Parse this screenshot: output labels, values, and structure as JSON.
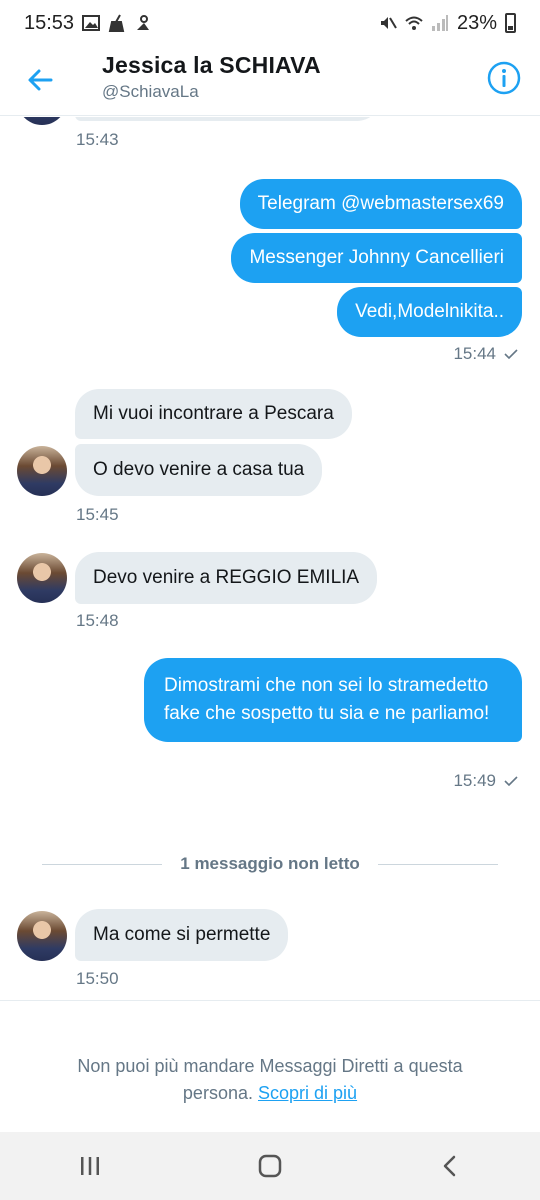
{
  "status_bar": {
    "time": "15:53",
    "battery": "23%"
  },
  "header": {
    "title": "Jessica la SCHIAVA",
    "handle": "@SchiavaLa"
  },
  "messages": {
    "time_1": "15:43",
    "out_1": "Telegram @webmastersex69",
    "out_2": "Messenger Johnny Cancellieri",
    "out_3": "Vedi,Modelnikita..",
    "time_2": "15:44",
    "in_1": "Mi vuoi incontrare a Pescara",
    "in_2": "O devo venire a casa tua",
    "time_3": "15:45",
    "in_3": "Devo venire a REGGIO EMILIA",
    "time_4": "15:48",
    "out_4": "Dimostrami che non sei lo stramedetto fake che sospetto tu sia e ne parliamo!",
    "time_5": "15:49",
    "unread_label": "1 messaggio non letto",
    "in_4": "Ma come si permette",
    "time_6": "15:50"
  },
  "footer": {
    "notice": "Non puoi più mandare Messaggi Diretti a questa persona.",
    "link": "Scopri di più"
  },
  "colors": {
    "accent": "#1da1f2",
    "incoming_bubble": "#e6ecf0",
    "muted_text": "#657786"
  },
  "icons": [
    "back-arrow-icon",
    "info-icon",
    "check-icon",
    "recents-icon",
    "home-icon",
    "back-icon"
  ]
}
